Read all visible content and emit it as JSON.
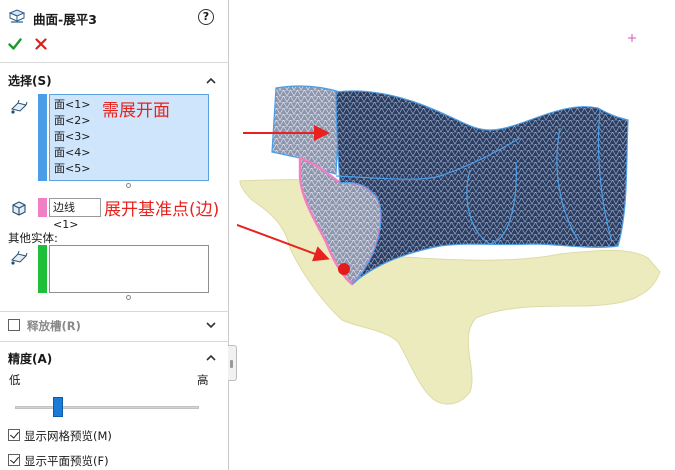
{
  "feature": {
    "title": "曲面-展平3",
    "help_glyph": "?",
    "ok_icon": "checkmark-icon",
    "cancel_icon": "close-icon"
  },
  "selection": {
    "header": "选择(S)",
    "faces": [
      "面<1>",
      "面<2>",
      "面<3>",
      "面<4>",
      "面<5>"
    ],
    "faces_color": "#4a9ee8",
    "edge_value": "边线<1>",
    "edge_color": "#f07fc4",
    "other_bodies_label": "其他实体:",
    "other_bodies_color": "#1fbf3a"
  },
  "relief": {
    "label": "释放槽(R)",
    "checked": false
  },
  "accuracy": {
    "header": "精度(A)",
    "low_label": "低",
    "high_label": "高",
    "level": 0.22
  },
  "options": {
    "mesh_preview_label": "显示网格预览(M)",
    "mesh_preview_checked": true,
    "flat_preview_label": "显示平面预览(F)",
    "flat_preview_checked": true
  },
  "viewport": {
    "annotation_faces": "需展开面",
    "annotation_edge": "展开基准点(边)",
    "annotation_color": "#e8231f",
    "flat_pattern_color": "#ecebbd"
  }
}
